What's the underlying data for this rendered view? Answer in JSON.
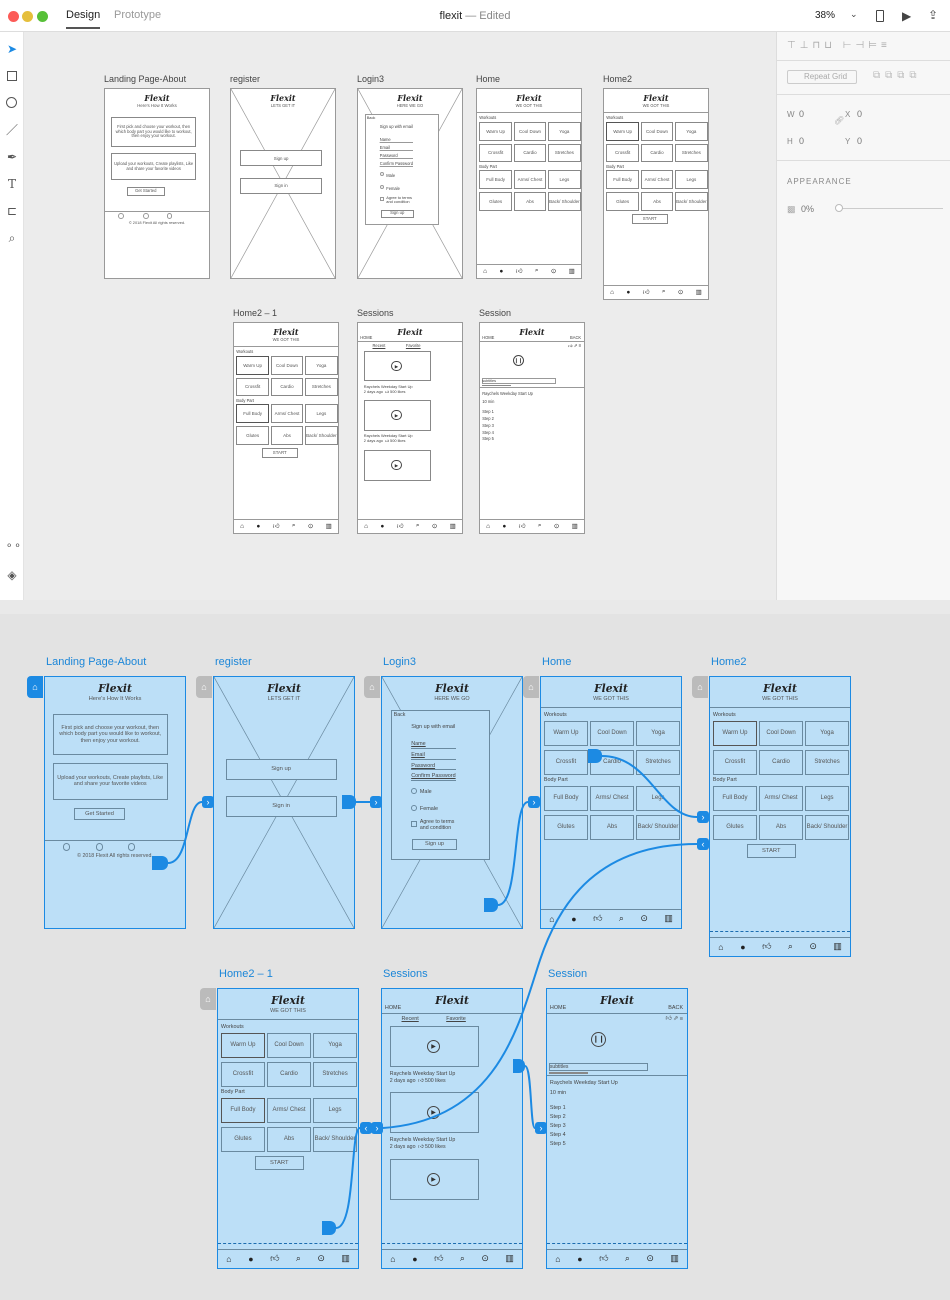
{
  "app": {
    "tabs": [
      "Design",
      "Prototype"
    ],
    "doc_name": "flexit",
    "doc_status": "— Edited",
    "zoom": "38%"
  },
  "panel": {
    "repeat_grid": "Repeat Grid",
    "w_label": "W",
    "w_value": "0",
    "h_label": "H",
    "h_value": "0",
    "x_label": "X",
    "x_value": "0",
    "y_label": "Y",
    "y_value": "0",
    "appearance": "APPEARANCE",
    "opacity": "0%"
  },
  "artboards": {
    "landing": "Landing Page-About",
    "register": "register",
    "login": "Login3",
    "home": "Home",
    "home2": "Home2",
    "home2_1": "Home2 – 1",
    "sessions": "Sessions",
    "session": "Session"
  },
  "screen": {
    "logo": "Flexit",
    "how_it_works": "Here's How It Works",
    "intro1": "First pick and choose your workout, then which body part you would like to workout, then enjoy your workout.",
    "intro2": "Upload your workouts, Create playlists, Like and share your favorite videos",
    "get_started": "Get Started",
    "copyright": "© 2018 Flexit All rights reserved.",
    "lets_get_it": "LETS GET IT",
    "sign_up": "Sign up",
    "sign_in": "Sign in",
    "here_we_go": "HERE WE GO",
    "back": "Back",
    "sign_up_with_email": "Sign up with email",
    "name": "Name",
    "email": "Email",
    "password": "Password",
    "confirm_password": "Confirm Password",
    "male": "Male",
    "female": "Female",
    "agree": "Agree to terms and condition",
    "sign_up_lower": "Sign up",
    "we_got_this": "WE GOT THIS",
    "workouts": "Workouts",
    "body_part": "Body Part",
    "workout_items": [
      "Warm Up",
      "Cool Down",
      "Yoga",
      "Crossfit",
      "Cardio",
      "Stretches"
    ],
    "body_items": [
      "Full Body",
      "Arms/ Chest",
      "Legs",
      "Glutes",
      "Abs",
      "Back/ Shoulder"
    ],
    "start": "START",
    "home_link": "HOME",
    "back_caps": "BACK",
    "recent": "Recent",
    "favorite": "Favorite",
    "video_title": "Raychels Weekday Start Up",
    "video_meta": "2 days ago",
    "video_likes": "500 likes",
    "subtitles": "subtitles",
    "duration": "10 min",
    "steps": [
      "Step 1",
      "Step 2",
      "Step 3",
      "Step 4",
      "Step 5"
    ]
  }
}
